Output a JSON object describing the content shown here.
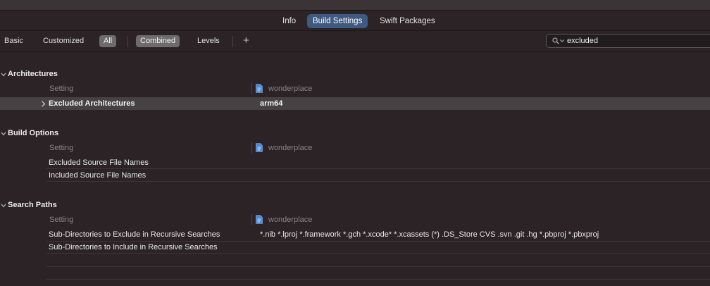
{
  "tabs": [
    {
      "label": "Info",
      "active": false
    },
    {
      "label": "Build Settings",
      "active": true
    },
    {
      "label": "Swift Packages",
      "active": false
    }
  ],
  "filters": {
    "basic": "Basic",
    "customized": "Customized",
    "all": "All",
    "combined": "Combined",
    "levels": "Levels",
    "add": "+"
  },
  "search": {
    "value": "excluded",
    "icon": "magnifier-icon"
  },
  "columns": {
    "setting": "Setting",
    "target": "wonderplace"
  },
  "sections": {
    "architectures": {
      "title": "Architectures",
      "rows": [
        {
          "label": "Excluded Architectures",
          "value": "arm64",
          "selected": true,
          "bold": true
        }
      ]
    },
    "build_options": {
      "title": "Build Options",
      "rows": [
        {
          "label": "Excluded Source File Names",
          "value": ""
        },
        {
          "label": "Included Source File Names",
          "value": ""
        }
      ]
    },
    "search_paths": {
      "title": "Search Paths",
      "rows": [
        {
          "label": "Sub-Directories to Exclude in Recursive Searches",
          "value": "*.nib *.lproj *.framework *.gch *.xcode* *.xcassets (*) .DS_Store CVS .svn .git .hg *.pbproj *.pbxproj"
        },
        {
          "label": "Sub-Directories to Include in Recursive Searches",
          "value": ""
        }
      ]
    }
  },
  "colors": {
    "selected_tab": "#3e5a80",
    "background": "#2b2325",
    "selected_row": "#474143"
  }
}
